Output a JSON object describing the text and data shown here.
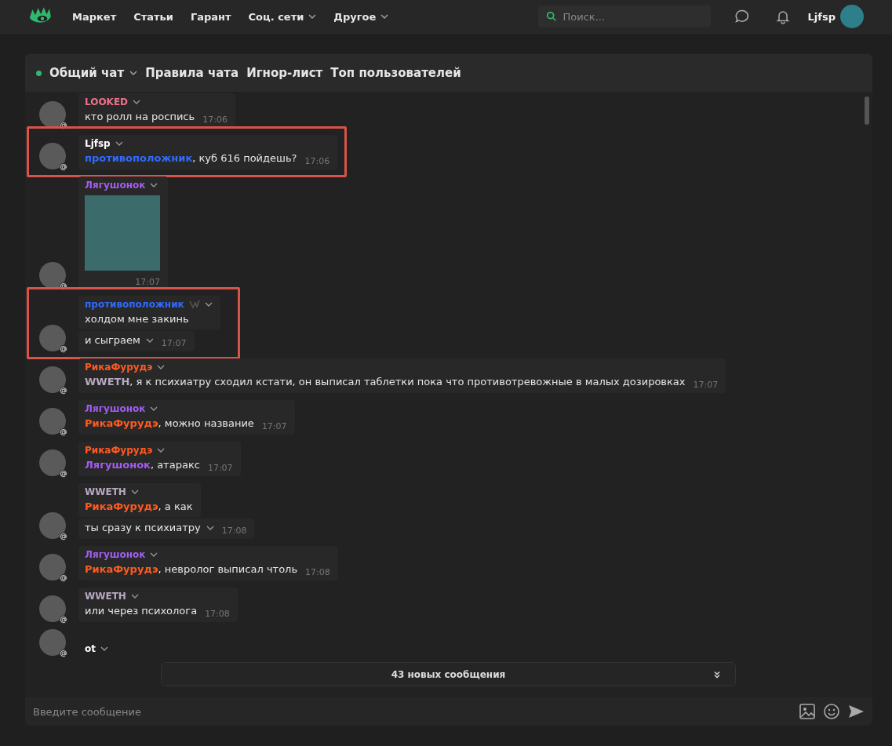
{
  "nav": {
    "links": [
      {
        "label": "Маркет",
        "has_menu": false
      },
      {
        "label": "Статьи",
        "has_menu": false
      },
      {
        "label": "Гарант",
        "has_menu": false
      },
      {
        "label": "Соц. сети",
        "has_menu": true
      },
      {
        "label": "Другое",
        "has_menu": true
      }
    ],
    "search": {
      "placeholder": "Поиск..."
    },
    "username": "Ljfsp"
  },
  "chat": {
    "tabs": [
      {
        "label": "Общий чат",
        "kind": "dropdown"
      },
      {
        "label": "Правила чата",
        "kind": "link"
      },
      {
        "label": "Игнор-лист",
        "kind": "link"
      },
      {
        "label": "Топ пользователей",
        "kind": "link"
      }
    ],
    "groups": [
      {
        "author": "LOOKED",
        "color": "#f0708a",
        "badge": false,
        "highlighted": false,
        "bubbles": [
          {
            "kind": "text",
            "text": "кто ролл на роспись",
            "time": "17:06",
            "caret": false
          }
        ]
      },
      {
        "author": "Ljfsp",
        "color": "#ffffff",
        "badge": false,
        "highlighted": true,
        "bubbles": [
          {
            "kind": "text",
            "mention": {
              "text": "противоположник",
              "color": "#2f6bff"
            },
            "text": ", куб 616 пойдешь?",
            "time": "17:06",
            "caret": false
          }
        ]
      },
      {
        "author": "Лягушонок",
        "color": "#a45cf2",
        "badge": false,
        "highlighted": false,
        "bubbles": [
          {
            "kind": "image",
            "time": "17:07"
          }
        ]
      },
      {
        "author": "противоположник",
        "color": "#2f6bff",
        "badge": true,
        "highlighted": true,
        "bubbles": [
          {
            "kind": "text",
            "text": "холдом мне закинь",
            "caret": false
          },
          {
            "kind": "text",
            "text": "и сыграем",
            "time": "17:07",
            "caret": true
          }
        ]
      },
      {
        "author": "РикаФурудэ",
        "color": "#ff5a1f",
        "badge": false,
        "highlighted": false,
        "bubbles": [
          {
            "kind": "text",
            "mention": {
              "text": "WWETH",
              "color": "#b8a8c0"
            },
            "text": ", я к психиатру сходил кстати, он выписал таблетки пока что противотревожные в малых дозировках",
            "time": "17:07",
            "caret": false
          }
        ]
      },
      {
        "author": "Лягушонок",
        "color": "#a45cf2",
        "badge": false,
        "highlighted": false,
        "bubbles": [
          {
            "kind": "text",
            "mention": {
              "text": "РикаФурудэ",
              "color": "#ff5a1f"
            },
            "text": ", можно название",
            "time": "17:07",
            "caret": false
          }
        ]
      },
      {
        "author": "РикаФурудэ",
        "color": "#ff5a1f",
        "badge": false,
        "highlighted": false,
        "bubbles": [
          {
            "kind": "text",
            "mention": {
              "text": "Лягушонок",
              "color": "#a45cf2"
            },
            "text": ", атаракс",
            "time": "17:07",
            "caret": false
          }
        ]
      },
      {
        "author": "WWETH",
        "color": "#b8a8c0",
        "badge": false,
        "highlighted": false,
        "bubbles": [
          {
            "kind": "text",
            "mention": {
              "text": "РикаФурудэ",
              "color": "#ff5a1f"
            },
            "text": ", а как",
            "caret": false
          },
          {
            "kind": "text",
            "text": "ты сразу к психиатру",
            "time": "17:08",
            "caret": true
          }
        ]
      },
      {
        "author": "Лягушонок",
        "color": "#a45cf2",
        "badge": false,
        "highlighted": false,
        "bubbles": [
          {
            "kind": "text",
            "mention": {
              "text": "РикаФурудэ",
              "color": "#ff5a1f"
            },
            "text": ", невролог выписал чтоль",
            "time": "17:08",
            "caret": false
          }
        ]
      },
      {
        "author": "WWETH",
        "color": "#b8a8c0",
        "badge": false,
        "highlighted": false,
        "bubbles": [
          {
            "kind": "text",
            "text": "или через психолога",
            "time": "17:08",
            "caret": false
          }
        ]
      },
      {
        "author": "ot",
        "color": "#ffffff",
        "badge": false,
        "highlighted": false
      }
    ],
    "new_messages": "43 новых сообщения",
    "input": {
      "placeholder": "Введите сообщение"
    }
  }
}
